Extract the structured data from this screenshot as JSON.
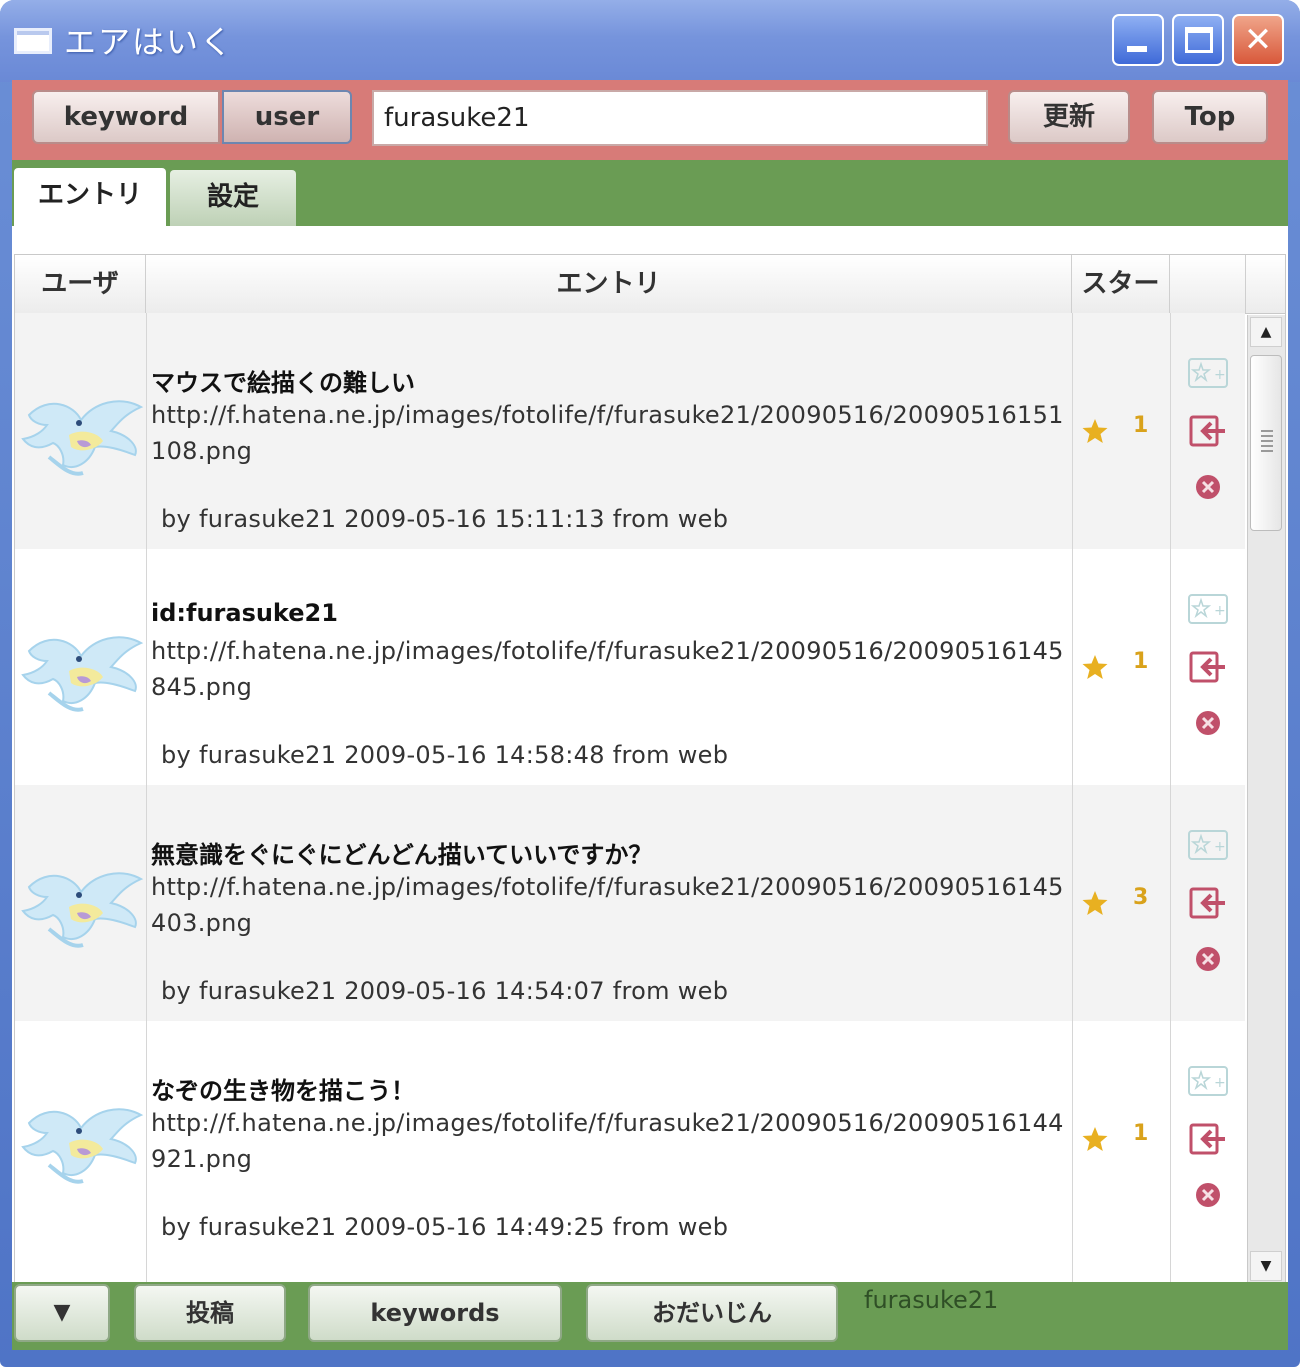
{
  "window": {
    "title": "エアはいく",
    "controls": [
      "minimize",
      "maximize",
      "close"
    ]
  },
  "toolbar": {
    "keyword_label": "keyword",
    "user_label": "user",
    "search_value": "furasuke21",
    "refresh_label": "更新",
    "top_label": "Top"
  },
  "tabs": [
    {
      "label": "エントリ",
      "active": true
    },
    {
      "label": "設定",
      "active": false
    }
  ],
  "table": {
    "columns": [
      "ユーザ",
      "エントリ",
      "スター"
    ],
    "rows": [
      {
        "title": "マウスで絵描くの難しい",
        "url": "http://f.hatena.ne.jp/images/fotolife/f/furasuke21/20090516/20090516151108.png",
        "meta": "by furasuke21 2009-05-16 15:11:13 from web",
        "stars": "1"
      },
      {
        "title": "id:furasuke21",
        "url": "http://f.hatena.ne.jp/images/fotolife/f/furasuke21/20090516/20090516145845.png",
        "meta": "by furasuke21 2009-05-16 14:58:48 from web",
        "stars": "1"
      },
      {
        "title": "無意識をぐにぐにどんどん描いていいですか？",
        "url": "http://f.hatena.ne.jp/images/fotolife/f/furasuke21/20090516/20090516145403.png",
        "meta": "by furasuke21 2009-05-16 14:54:07 from web",
        "stars": "3"
      },
      {
        "title": "なぞの生き物を描こう！",
        "url": "http://f.hatena.ne.jp/images/fotolife/f/furasuke21/20090516/20090516144921.png",
        "meta": "by furasuke21 2009-05-16 14:49:25 from web",
        "stars": "1"
      }
    ]
  },
  "bottombar": {
    "menu_label": "▼",
    "post_label": "投稿",
    "keywords_label": "keywords",
    "odaijin_label": "おだいじん",
    "status_user": "furasuke21"
  },
  "colors": {
    "titlebar": "#7694dc",
    "toolbar": "#d77b78",
    "tabbar": "#6a9c54",
    "star": "#e8b021",
    "action_icon": "#c0506a"
  },
  "icons": {
    "star": "star-icon",
    "add_star": "add-star-icon",
    "reply": "reply-icon",
    "delete": "delete-icon"
  }
}
